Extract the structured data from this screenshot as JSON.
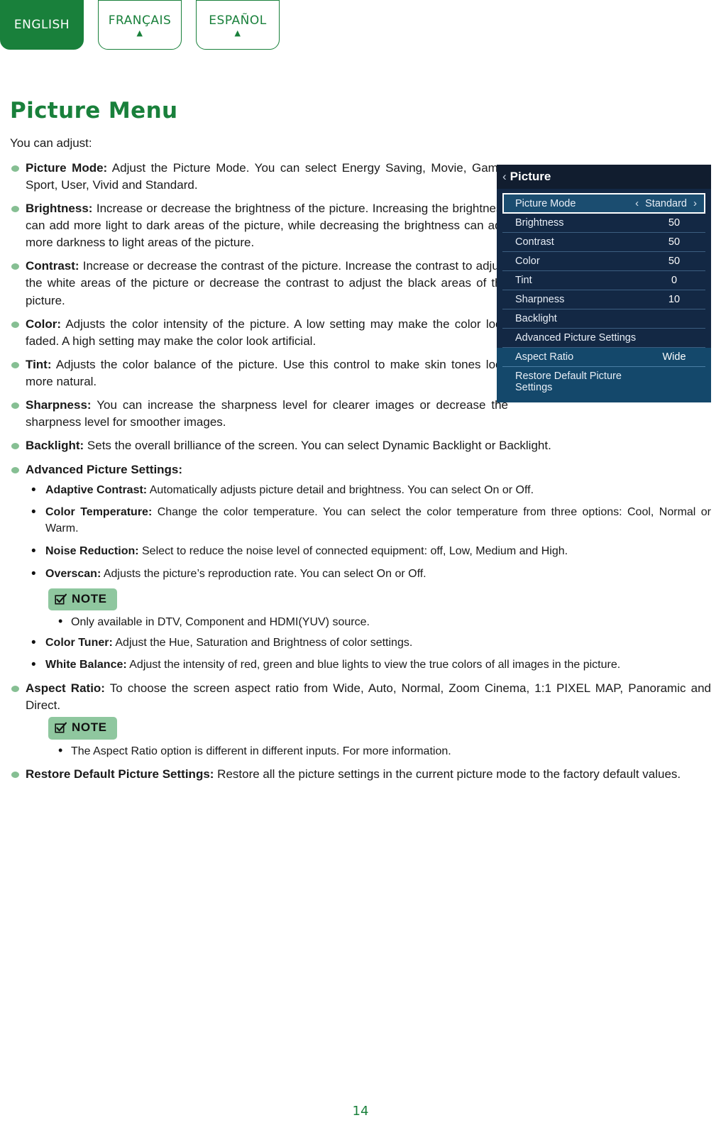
{
  "language_tabs": [
    {
      "label": "ENGLISH",
      "active": true,
      "marker": ""
    },
    {
      "label": "FRANÇAIS",
      "active": false,
      "marker": "▲"
    },
    {
      "label": "ESPAÑOL",
      "active": false,
      "marker": "▲"
    }
  ],
  "page": {
    "title": "Picture Menu",
    "intro": "You can adjust:",
    "number": "14"
  },
  "items": [
    {
      "term": "Picture Mode:",
      "text": " Adjust the Picture Mode. You can select Energy Saving, Movie, Game, Sport, User, Vivid and Standard."
    },
    {
      "term": "Brightness:",
      "text": " Increase or decrease the brightness of the picture. Increasing the brightness can add more light to dark areas of the picture, while decreasing the brightness can add more darkness to light areas of the picture."
    },
    {
      "term": "Contrast:",
      "text": " Increase or decrease the contrast of the picture. Increase the contrast to adjust the white areas of the picture or decrease the contrast to adjust the black areas of the picture."
    },
    {
      "term": "Color:",
      "text": " Adjusts the color intensity of the picture. A low setting may make the color look faded. A high setting may make the color look artificial."
    },
    {
      "term": "Tint:",
      "text": " Adjusts the color balance of the picture. Use this control to make skin tones look more natural."
    },
    {
      "term": "Sharpness:",
      "text": " You can increase the sharpness level for clearer images or decrease the sharpness level for smoother images."
    },
    {
      "term": "Backlight:",
      "text": " Sets the overall brilliance of the screen. You can select Dynamic Backlight or Backlight."
    },
    {
      "term": "Advanced Picture Settings:",
      "text": ""
    }
  ],
  "advanced_sub_items": [
    {
      "term": "Adaptive Contrast:",
      "text": " Automatically adjusts picture detail and brightness. You can select On or Off."
    },
    {
      "term": "Color Temperature:",
      "text": " Change the color temperature. You can select the color temperature from three options: Cool, Normal or Warm."
    },
    {
      "term": "Noise Reduction:",
      "text": " Select to reduce the noise level of connected equipment: off, Low, Medium and High."
    },
    {
      "term": "Overscan:",
      "text": " Adjusts the picture’s reproduction rate. You can select On or Off."
    }
  ],
  "note_one": {
    "label": "NOTE",
    "icon": "checkbox-checked-icon",
    "bullets": [
      "Only available in DTV, Component and HDMI(YUV) source."
    ]
  },
  "advanced_sub_items_after_note": [
    {
      "term": "Color Tuner:",
      "text": " Adjust the Hue, Saturation and Brightness of color settings."
    },
    {
      "term": "White Balance:",
      "text": " Adjust the intensity of red, green and blue lights to view the true colors of all images in the picture."
    }
  ],
  "aspect_ratio_item": {
    "term": "Aspect Ratio:",
    "text": " To choose the screen aspect ratio from Wide, Auto, Normal, Zoom Cinema, 1:1 PIXEL MAP, Panoramic and Direct."
  },
  "note_two": {
    "label": "NOTE",
    "icon": "checkbox-checked-icon",
    "bullets": [
      "The Aspect Ratio option is different in different inputs. For more information."
    ]
  },
  "restore_item": {
    "term": "Restore Default Picture Settings:",
    "text": " Restore all the picture settings in the current picture mode to the factory default values."
  },
  "osd": {
    "header": "Picture",
    "back_icon": "‹",
    "rows": [
      {
        "label": "Picture Mode",
        "value": "Standard",
        "selected": true,
        "left_chev": "‹",
        "right_chev": "›"
      },
      {
        "label": "Brightness",
        "value": "50",
        "selected": false
      },
      {
        "label": "Contrast",
        "value": "50",
        "selected": false
      },
      {
        "label": "Color",
        "value": "50",
        "selected": false
      },
      {
        "label": "Tint",
        "value": "0",
        "selected": false
      },
      {
        "label": "Sharpness",
        "value": "10",
        "selected": false
      },
      {
        "label": "Backlight",
        "value": "",
        "selected": false
      },
      {
        "label": "Advanced Picture Settings",
        "value": "",
        "selected": false
      }
    ],
    "bottom_rows": [
      {
        "label": "Aspect Ratio",
        "value": "Wide"
      },
      {
        "label": "Restore Default Picture Settings",
        "value": ""
      }
    ]
  },
  "colors": {
    "brand_green": "#19803b",
    "bullet_green": "#86bf93",
    "note_green": "#8fc79f",
    "osd_header_bg": "#111d2f",
    "osd_bg": "#132844",
    "osd_selected_bg": "#1b4d70",
    "osd_bottom_bg": "#14486b"
  }
}
